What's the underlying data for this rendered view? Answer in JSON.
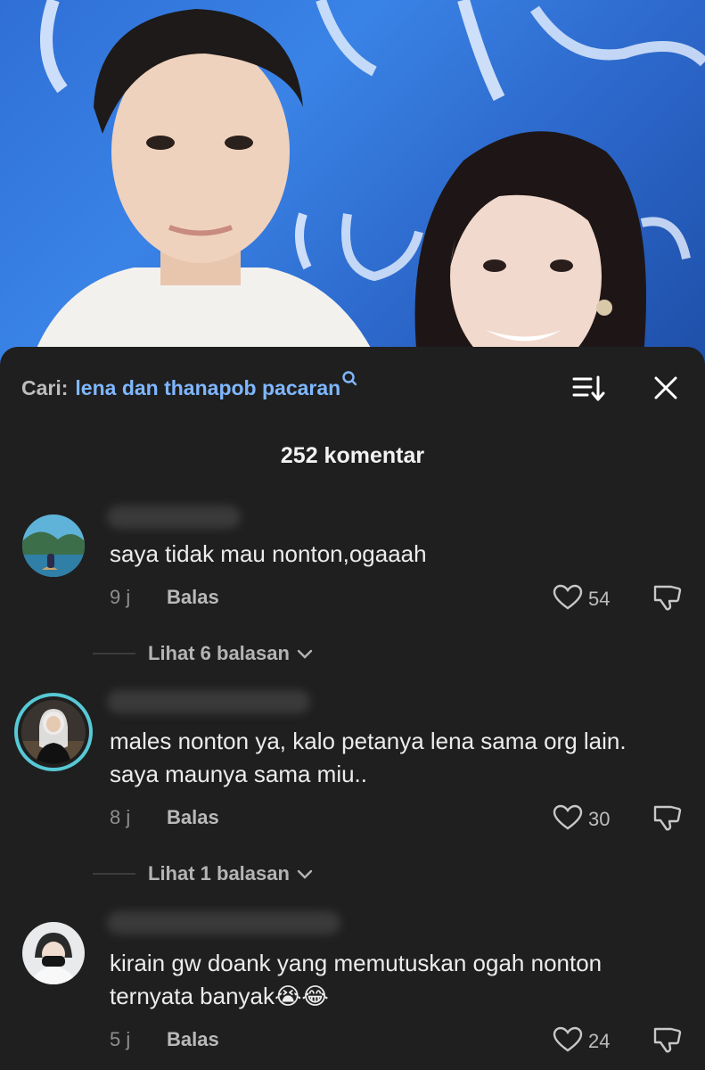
{
  "search": {
    "prefix": "Cari:",
    "query": "lena dan thanapob pacaran"
  },
  "comment_count": "252 komentar",
  "comments": [
    {
      "text": "saya tidak mau nonton,ogaaah",
      "time": "9 j",
      "reply_label": "Balas",
      "likes": "54",
      "view_replies": "Lihat 6 balasan"
    },
    {
      "text": "males nonton ya, kalo petanya lena sama org lain. saya maunya sama miu..",
      "time": "8 j",
      "reply_label": "Balas",
      "likes": "30",
      "view_replies": "Lihat 1 balasan"
    },
    {
      "text": "kirain gw doank yang memutuskan ogah nonton ternyata banyak😭😂",
      "time": "5 j",
      "reply_label": "Balas",
      "likes": "24"
    }
  ],
  "icons": {
    "search": "search-icon",
    "sort": "sort-icon",
    "close": "close-icon",
    "like": "heart-icon",
    "dislike": "thumbs-down-icon",
    "chevron": "chevron-down-icon"
  },
  "colors": {
    "sheet_bg": "#1f1f1f",
    "query": "#7fb7ff",
    "story_ring": "#57c9d6"
  }
}
